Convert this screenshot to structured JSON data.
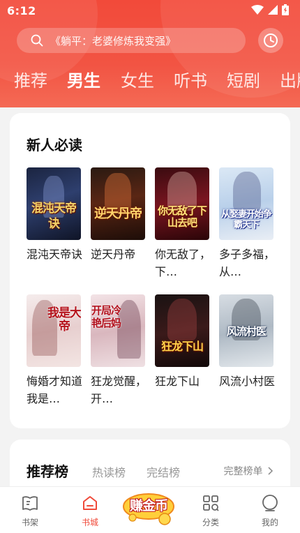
{
  "status_bar": {
    "time": "6:12"
  },
  "search": {
    "placeholder": "《躺平：老婆修炼我变强》"
  },
  "tabs": [
    {
      "label": "推荐"
    },
    {
      "label": "男生"
    },
    {
      "label": "女生"
    },
    {
      "label": "听书"
    },
    {
      "label": "短剧"
    },
    {
      "label": "出版"
    }
  ],
  "new_readers": {
    "title": "新人必读",
    "books": [
      {
        "name": "混沌天帝诀",
        "cover_text": "混沌天帝诀"
      },
      {
        "name": "逆天丹帝",
        "cover_text": "逆天丹帝"
      },
      {
        "name": "你无敌了，下…",
        "cover_text": "你无敌了下山去吧"
      },
      {
        "name": "多子多福，从…",
        "cover_text": "从娶妻开始争霸天下"
      },
      {
        "name": "悔婚才知道我是…",
        "cover_text": "我是大帝"
      },
      {
        "name": "狂龙觉醒，开…",
        "cover_text": "开局冷艳后妈"
      },
      {
        "name": "狂龙下山",
        "cover_text": "狂龙下山"
      },
      {
        "name": "风流小村医",
        "cover_text": "风流村医"
      }
    ]
  },
  "ranking": {
    "title": "推荐榜",
    "tabs": [
      "热读榜",
      "完结榜"
    ],
    "more": "完整榜单"
  },
  "bottom_nav": {
    "shelf": "书架",
    "store": "书城",
    "earn": "赚金币",
    "category": "分类",
    "mine": "我的"
  },
  "colors": {
    "accent": "#f24a3a"
  }
}
